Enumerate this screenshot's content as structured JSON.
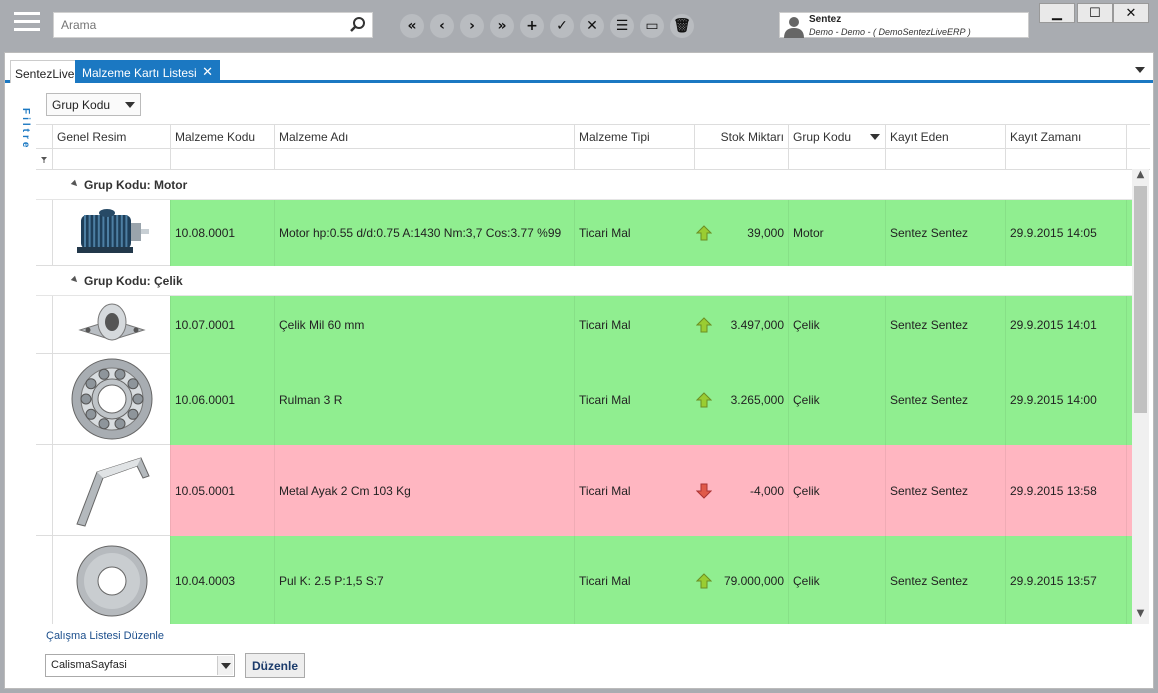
{
  "search": {
    "placeholder": "Arama"
  },
  "toolbar": {
    "buttons": [
      {
        "name": "first-record-button",
        "glyph": "«"
      },
      {
        "name": "prev-record-button",
        "glyph": "‹"
      },
      {
        "name": "next-record-button",
        "glyph": "›"
      },
      {
        "name": "last-record-button",
        "glyph": "»"
      },
      {
        "name": "add-button",
        "glyph": "+"
      },
      {
        "name": "save-button",
        "glyph": "✓"
      },
      {
        "name": "cancel-button",
        "glyph": "✕"
      },
      {
        "name": "list-button",
        "glyph": "☰"
      },
      {
        "name": "keyboard-button",
        "glyph": "▭"
      },
      {
        "name": "delete-button",
        "glyph": "🗑"
      }
    ]
  },
  "user": {
    "name": "Sentez",
    "subtitle": "Demo - Demo - ( DemoSentezLiveERP )"
  },
  "window": {
    "minimize": "▁",
    "maximize": "☐",
    "close": "✕"
  },
  "tabs": {
    "home": "SentezLive",
    "active": "Malzeme Kartı Listesi",
    "close": "✕"
  },
  "filter_label": "Filtre",
  "group_select": "Grup Kodu",
  "columns": [
    "Genel Resim",
    "Malzeme Kodu",
    "Malzeme Adı",
    "Malzeme Tipi",
    "Stok Miktarı",
    "Grup Kodu",
    "Kayıt Eden",
    "Kayıt Zamanı"
  ],
  "groups": [
    {
      "title": "Grup Kodu: Motor",
      "rows": [
        {
          "image": "motor",
          "code": "10.08.0001",
          "name": "Motor hp:0.55 d/d:0.75 A:1430 Nm:3,7 Cos:3.77 %99",
          "type": "Ticari Mal",
          "trend": "up",
          "qty": "39,000",
          "group": "Motor",
          "by": "Sentez Sentez",
          "time": "29.9.2015 14:05",
          "status": "positive"
        }
      ]
    },
    {
      "title": "Grup Kodu: Çelik",
      "rows": [
        {
          "image": "shaft",
          "code": "10.07.0001",
          "name": "Çelik Mil 60 mm",
          "type": "Ticari Mal",
          "trend": "up",
          "qty": "3.497,000",
          "group": "Çelik",
          "by": "Sentez Sentez",
          "time": "29.9.2015 14:01",
          "status": "positive"
        },
        {
          "image": "bearing",
          "code": "10.06.0001",
          "name": "Rulman 3 R",
          "type": "Ticari Mal",
          "trend": "up",
          "qty": "3.265,000",
          "group": "Çelik",
          "by": "Sentez Sentez",
          "time": "29.9.2015 14:00",
          "status": "positive"
        },
        {
          "image": "bracket",
          "code": "10.05.0001",
          "name": "Metal Ayak 2 Cm 103 Kg",
          "type": "Ticari Mal",
          "trend": "down",
          "qty": "-4,000",
          "group": "Çelik",
          "by": "Sentez Sentez",
          "time": "29.9.2015 13:58",
          "status": "negative"
        },
        {
          "image": "washer",
          "code": "10.04.0003",
          "name": "Pul K: 2.5 P:1,5 S:7",
          "type": "Ticari Mal",
          "trend": "up",
          "qty": "79.000,000",
          "group": "Çelik",
          "by": "Sentez Sentez",
          "time": "29.9.2015 13:57",
          "status": "positive"
        }
      ]
    }
  ],
  "colors": {
    "positive": "#90ee90",
    "negative": "#ffb6c1",
    "accent": "#1b78c2",
    "up_arrow": "#9acd32",
    "down_arrow": "#e05a4a"
  },
  "worklist": {
    "label": "Çalışma Listesi Düzenle",
    "select": "CalismaSayfasi",
    "button": "Düzenle"
  }
}
